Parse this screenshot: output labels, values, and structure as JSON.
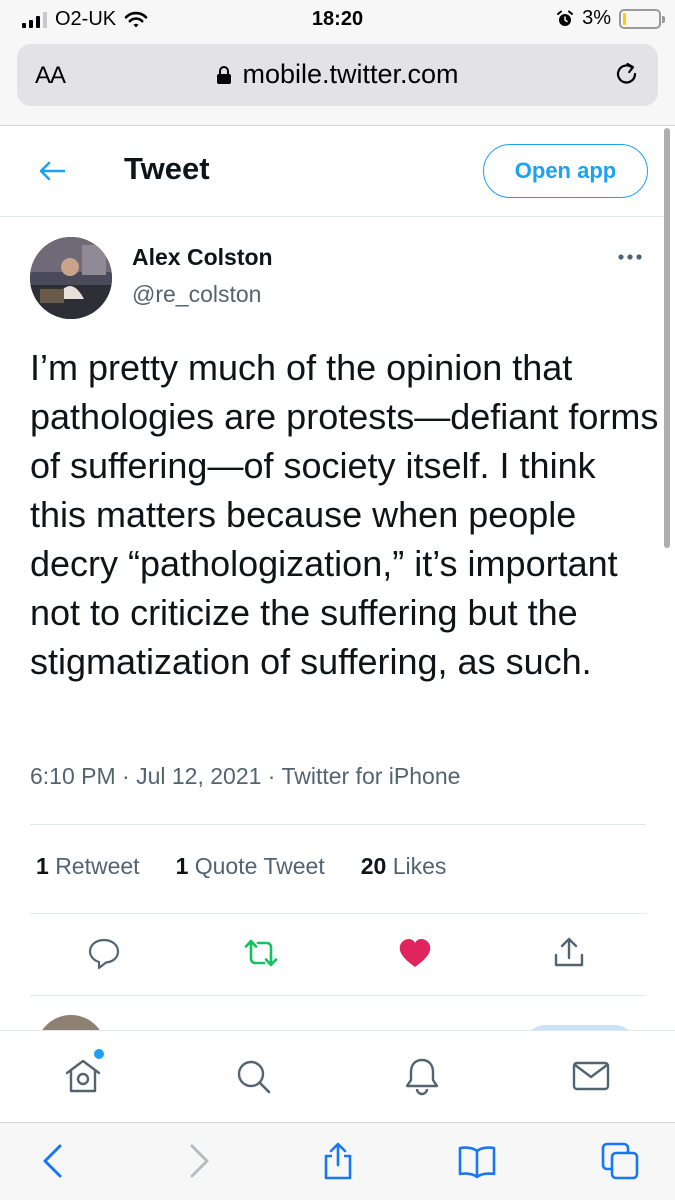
{
  "status_bar": {
    "carrier": "O2-UK",
    "time": "18:20",
    "battery": "3%",
    "battery_level": 0.03,
    "battery_color": "#ffcc00"
  },
  "browser": {
    "text_size_label": "AA",
    "url": "mobile.twitter.com"
  },
  "header": {
    "title": "Tweet",
    "open_app_label": "Open app"
  },
  "tweet": {
    "author_name": "Alex Colston",
    "author_handle": "@re_colston",
    "text": "I’m pretty much of the opinion that pathologies are protests—defiant forms of suffering—of society itself. I think this matters because when people decry “pathologization,” it’s important not to criticize the suffering but the stigmatization of suffering, as such.",
    "meta": "6:10 PM · Jul 12, 2021 · Twitter for iPhone",
    "stats": [
      {
        "count": "1",
        "label": "Retweet"
      },
      {
        "count": "1",
        "label": "Quote Tweet"
      },
      {
        "count": "20",
        "label": "Likes"
      }
    ],
    "liked": true
  },
  "colors": {
    "accent": "#1da1f2",
    "retweet": "#17bf63",
    "like": "#e0245e",
    "secondary_text": "#536471"
  },
  "bottom_nav": [
    "home-icon",
    "search-icon",
    "bell-icon",
    "mail-icon"
  ],
  "safari_toolbar": [
    "back-icon",
    "forward-icon",
    "share-icon",
    "bookmarks-icon",
    "tabs-icon"
  ]
}
